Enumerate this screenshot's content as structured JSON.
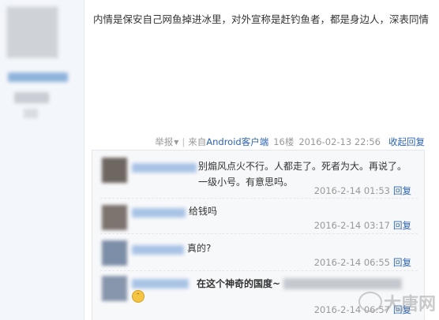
{
  "post": {
    "text": "内情是保安自己网鱼掉进冰里，对外宣称是赶钓鱼者，都是身边人，深表同情",
    "tail": {
      "report": "举报",
      "from": "来自",
      "client": "Android客户端",
      "floor": "16楼",
      "time": "2016-02-13 22:56",
      "collapse_label": "收起回复"
    }
  },
  "replies": [
    {
      "username": "",
      "text": "别煽风点火不行。人都走了。死者为大。再说了。一级小号。有意思吗。",
      "time": "2016-2-14 01:53",
      "reply_label": "回复"
    },
    {
      "username": "",
      "text": "给钱吗",
      "time": "2016-2-14 03:17",
      "reply_label": "回复"
    },
    {
      "username": "",
      "text": "真的?",
      "time": "2016-2-14 06:55",
      "reply_label": "回复"
    },
    {
      "username": "",
      "text": "在这个神奇的国度~",
      "time": "2016-2-14 06:57",
      "reply_label": "回复"
    }
  ],
  "watermark": "大唐网",
  "colors": {
    "link": "#2d64b3",
    "meta": "#999999",
    "reply_bg": "#f7f8fa"
  }
}
